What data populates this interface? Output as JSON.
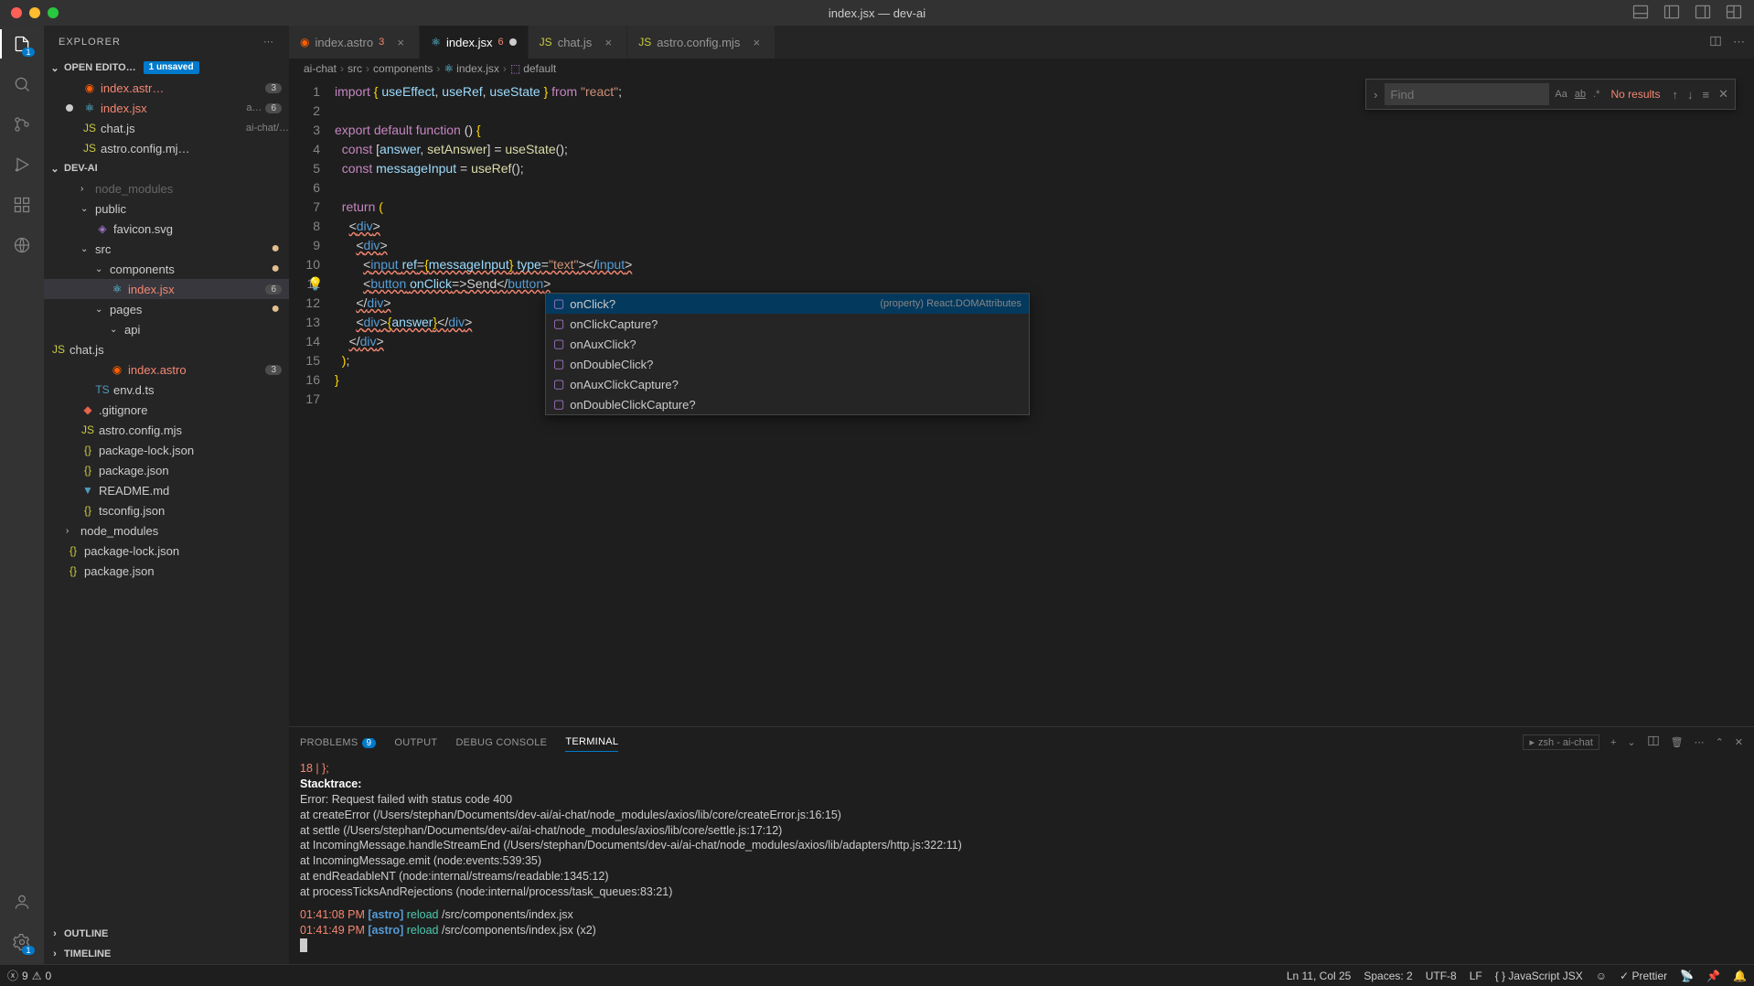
{
  "window": {
    "title": "index.jsx — dev-ai"
  },
  "activity": {
    "explorer_badge": "1",
    "settings_badge": "1"
  },
  "sidebar": {
    "title": "EXPLORER",
    "openEditors": {
      "label": "OPEN EDITO…",
      "unsaved": "1 unsaved",
      "items": [
        {
          "name": "index.astr…",
          "badge": "3",
          "icon": "astro",
          "err": true
        },
        {
          "name": "index.jsx",
          "suffix": "a…",
          "badge": "6",
          "icon": "react",
          "err": true,
          "modified": true
        },
        {
          "name": "chat.js",
          "suffix": "ai-chat/…",
          "icon": "js"
        },
        {
          "name": "astro.config.mj…",
          "icon": "js"
        }
      ]
    },
    "project": {
      "label": "DEV-AI",
      "tree": [
        {
          "name": "node_modules",
          "depth": 1,
          "dim": true,
          "chev": "›"
        },
        {
          "name": "public",
          "depth": 1,
          "chev": "⌄",
          "folder": true
        },
        {
          "name": "favicon.svg",
          "depth": 2,
          "icon": "svg"
        },
        {
          "name": "src",
          "depth": 1,
          "chev": "⌄",
          "folder": true,
          "mod": true
        },
        {
          "name": "components",
          "depth": 2,
          "chev": "⌄",
          "folder": true,
          "mod": true
        },
        {
          "name": "index.jsx",
          "depth": 3,
          "icon": "react",
          "badge": "6",
          "err": true,
          "active": true
        },
        {
          "name": "pages",
          "depth": 2,
          "chev": "⌄",
          "folder": true,
          "mod": true
        },
        {
          "name": "api",
          "depth": 3,
          "chev": "⌄",
          "folder": true
        },
        {
          "name": "chat.js",
          "depth": 4,
          "icon": "js"
        },
        {
          "name": "index.astro",
          "depth": 3,
          "icon": "astro",
          "badge": "3",
          "err": true
        },
        {
          "name": "env.d.ts",
          "depth": 2,
          "icon": "ts"
        },
        {
          "name": ".gitignore",
          "depth": 1,
          "icon": "git"
        },
        {
          "name": "astro.config.mjs",
          "depth": 1,
          "icon": "js"
        },
        {
          "name": "package-lock.json",
          "depth": 1,
          "icon": "json"
        },
        {
          "name": "package.json",
          "depth": 1,
          "icon": "json"
        },
        {
          "name": "README.md",
          "depth": 1,
          "icon": "md"
        },
        {
          "name": "tsconfig.json",
          "depth": 1,
          "icon": "json"
        },
        {
          "name": "node_modules",
          "depth": 0,
          "chev": "›",
          "folder": true
        },
        {
          "name": "package-lock.json",
          "depth": 0,
          "icon": "json"
        },
        {
          "name": "package.json",
          "depth": 0,
          "icon": "json"
        }
      ]
    },
    "outline": "OUTLINE",
    "timeline": "TIMELINE"
  },
  "tabs": [
    {
      "name": "index.astro",
      "icon": "astro",
      "err": "3"
    },
    {
      "name": "index.jsx",
      "icon": "react",
      "err": "6",
      "active": true,
      "unsaved": true
    },
    {
      "name": "chat.js",
      "icon": "js"
    },
    {
      "name": "astro.config.mjs",
      "icon": "js"
    }
  ],
  "breadcrumb": [
    "ai-chat",
    "src",
    "components",
    "index.jsx",
    "default"
  ],
  "find": {
    "placeholder": "Find",
    "results": "No results"
  },
  "code": {
    "lines": 17,
    "l1": "import { useEffect, useRef, useState } from \"react\";",
    "l3": "export default function () {",
    "l4": "  const [answer, setAnswer] = useState();",
    "l5": "  const messageInput = useRef();",
    "l7": "  return (",
    "l8": "    <div>",
    "l9": "      <div>",
    "l10": "        <input ref={messageInput} type=\"text\"></input>",
    "l11": "        <button onClick=>Send</button>",
    "l12": "      </div>",
    "l13": "      <div>{answer}</div>",
    "l14": "    </div>",
    "l15": "  );",
    "l16": "}"
  },
  "suggest": {
    "detail": "(property) React.DOMAttributes<HTMLButtonEle…",
    "items": [
      "onClick?",
      "onClickCapture?",
      "onAuxClick?",
      "onDoubleClick?",
      "onAuxClickCapture?",
      "onDoubleClickCapture?"
    ]
  },
  "panel": {
    "tabs": {
      "problems": "PROBLEMS",
      "problems_count": "9",
      "output": "OUTPUT",
      "debug": "DEBUG CONSOLE",
      "terminal": "TERMINAL"
    },
    "terminal_selector": "zsh - ai-chat",
    "terminal": {
      "l1": "  18 | };",
      "l2": "  Stacktrace:",
      "l3": "Error: Request failed with status code 400",
      "l4": "    at createError (/Users/stephan/Documents/dev-ai/ai-chat/node_modules/axios/lib/core/createError.js:16:15)",
      "l5": "    at settle (/Users/stephan/Documents/dev-ai/ai-chat/node_modules/axios/lib/core/settle.js:17:12)",
      "l6": "    at IncomingMessage.handleStreamEnd (/Users/stephan/Documents/dev-ai/ai-chat/node_modules/axios/lib/adapters/http.js:322:11)",
      "l7": "    at IncomingMessage.emit (node:events:539:35)",
      "l8": "    at endReadableNT (node:internal/streams/readable:1345:12)",
      "l9": "    at processTicksAndRejections (node:internal/process/task_queues:83:21)",
      "r1_time": "01:41:08 PM",
      "r1_tag": "[astro]",
      "r1_action": "reload",
      "r1_path": "/src/components/index.jsx",
      "r2_time": "01:41:49 PM",
      "r2_tag": "[astro]",
      "r2_action": "reload",
      "r2_path": "/src/components/index.jsx (x2)"
    }
  },
  "status": {
    "errors": "9",
    "warnings": "0",
    "cursor": "Ln 11, Col 25",
    "spaces": "Spaces: 2",
    "encoding": "UTF-8",
    "eol": "LF",
    "lang": "JavaScript JSX",
    "prettier": "Prettier"
  }
}
